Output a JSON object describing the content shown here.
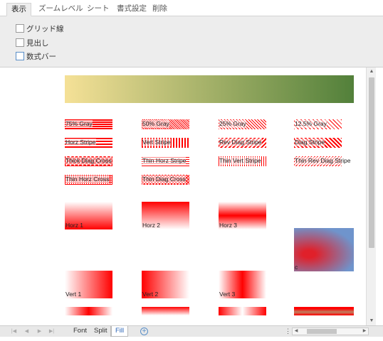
{
  "ribbon": {
    "tabs": [
      {
        "label": "表示",
        "active": true
      },
      {
        "label": "ズームレベル"
      },
      {
        "label": "シート"
      },
      {
        "label": "書式設定"
      },
      {
        "label": "削除"
      }
    ],
    "options": [
      {
        "label": "グリッド線",
        "checked": false
      },
      {
        "label": "見出し",
        "checked": false
      },
      {
        "label": "数式バー",
        "checked": false
      }
    ]
  },
  "sheet": {
    "gradient_banner": {
      "from": "#f5e197",
      "to": "#52803a"
    },
    "pattern_fills": [
      {
        "label": "75% Gray",
        "pattern": "gray75"
      },
      {
        "label": "50% Gray",
        "pattern": "gray50"
      },
      {
        "label": "25% Gray",
        "pattern": "gray25"
      },
      {
        "label": "12.5% Gray",
        "pattern": "gray125"
      },
      {
        "label": "Horz Stripe",
        "pattern": "horz"
      },
      {
        "label": "Vert Stripe",
        "pattern": "vert"
      },
      {
        "label": "Rev Diag Stripe",
        "pattern": "revdiag"
      },
      {
        "label": "Diag Stripe",
        "pattern": "diag"
      },
      {
        "label": "Thick Diag Cross",
        "pattern": "thickcross"
      },
      {
        "label": "Thin Horz Stripe",
        "pattern": "thinhorz"
      },
      {
        "label": "Thin Vert Stripe",
        "pattern": "thinvert"
      },
      {
        "label": "Thin Rev Diag Stripe",
        "pattern": "thinrevdiag"
      },
      {
        "label": "Thin Horz Cross",
        "pattern": "thinhorzcross"
      },
      {
        "label": "Thin Diag Cross",
        "pattern": "thindiagcross"
      }
    ],
    "gradient_fills": [
      {
        "label": "Horz 1",
        "kind": "horz1"
      },
      {
        "label": "Horz 2",
        "kind": "horz2"
      },
      {
        "label": "Horz 3",
        "kind": "horz3"
      },
      {
        "label": "c",
        "kind": "path"
      },
      {
        "label": "Vert 1",
        "kind": "vert1"
      },
      {
        "label": "Vert 2",
        "kind": "vert2"
      },
      {
        "label": "Vert 3",
        "kind": "vert3"
      }
    ],
    "colors": {
      "fill": "#ff0000",
      "path_outer": "#6f94cc",
      "path_inner": "#e0202a"
    }
  },
  "sheet_tabs": {
    "tabs": [
      {
        "label": "Font"
      },
      {
        "label": "Split"
      },
      {
        "label": "Fill",
        "active": true
      }
    ],
    "add_label": "+",
    "split_glyph": "⋮"
  }
}
